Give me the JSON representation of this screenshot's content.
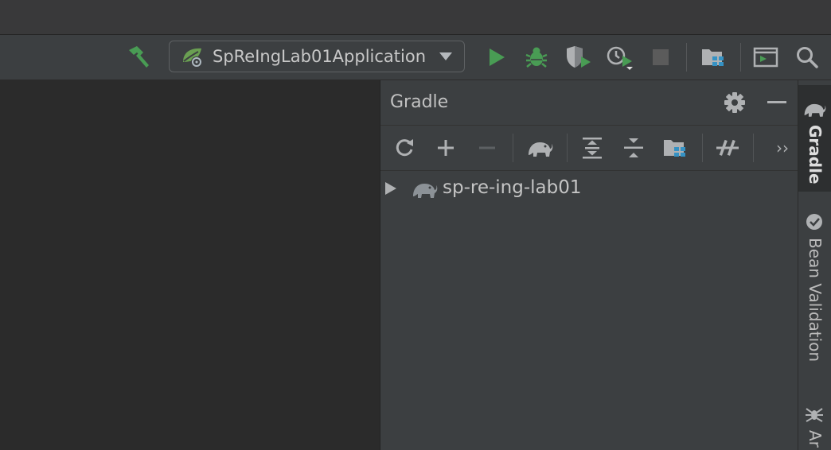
{
  "toolbar": {
    "build_icon": "hammer-icon",
    "run_configuration": {
      "label": "SpReIngLab01Application",
      "icon": "spring-boot-icon",
      "dropdown_icon": "chevron-down-icon"
    },
    "run_icon": "play-icon",
    "debug_icon": "bug-icon",
    "coverage_icon": "shield-run-icon",
    "profile_icon": "profiler-icon",
    "stop_icon": "stop-icon",
    "project_structure_icon": "folder-grid-icon",
    "terminal_icon": "terminal-icon",
    "search_icon": "search-icon",
    "colors": {
      "run_green": "#499c54",
      "stop_gray": "#5b5b5b"
    }
  },
  "gradle_panel": {
    "title": "Gradle",
    "settings_icon": "gear-icon",
    "hide_icon": "minimize-icon",
    "actions": [
      {
        "name": "reload",
        "icon": "refresh-icon"
      },
      {
        "name": "add",
        "icon": "plus-icon"
      },
      {
        "name": "remove",
        "icon": "minus-icon"
      },
      {
        "name": "execute-task",
        "icon": "elephant-icon"
      },
      {
        "name": "expand-all",
        "icon": "expand-all-icon"
      },
      {
        "name": "collapse-all",
        "icon": "collapse-all-icon"
      },
      {
        "name": "project-settings",
        "icon": "folder-grid-icon"
      },
      {
        "name": "toggle-offline",
        "icon": "offline-icon"
      }
    ],
    "more_label": "››",
    "tree": [
      {
        "label": "sp-re-ing-lab01",
        "expanded": false
      }
    ]
  },
  "right_strip": {
    "tabs": [
      {
        "label": "Gradle",
        "active": true,
        "icon": "elephant-icon"
      },
      {
        "label": "Bean Validation",
        "active": false,
        "icon": "bean-validation-icon"
      },
      {
        "label": "Ar",
        "active": false,
        "icon": "spider-icon"
      }
    ]
  }
}
